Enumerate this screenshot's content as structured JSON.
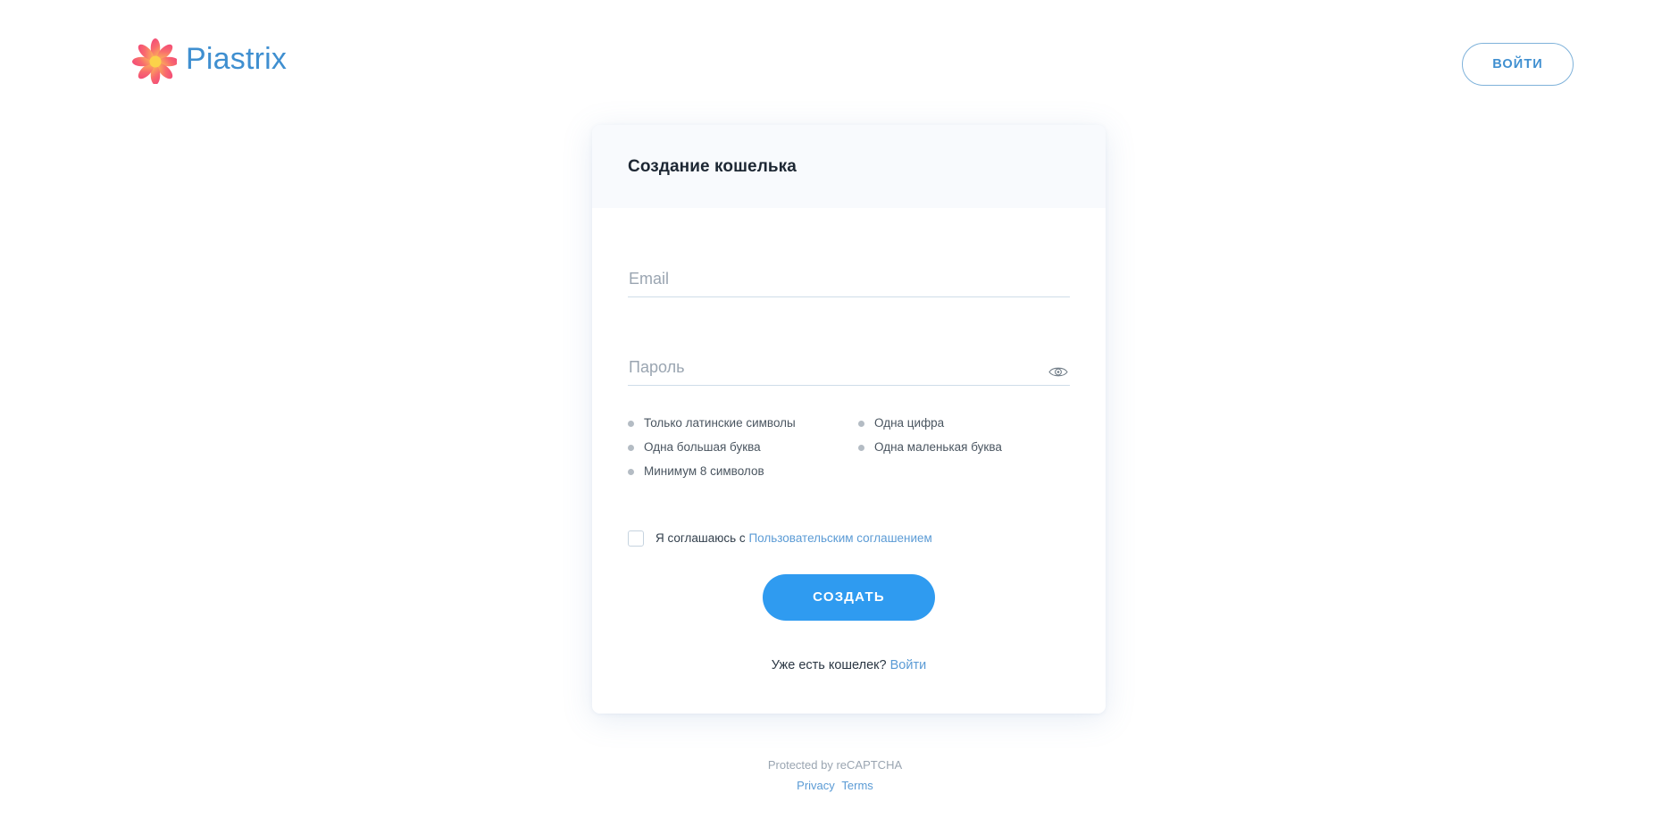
{
  "header": {
    "brand_name": "Piastrix",
    "brand_icon": "piastrix-flower-logo",
    "login_label": "ВОЙТИ"
  },
  "card": {
    "title": "Создание кошелька",
    "email": {
      "label": "Email",
      "placeholder": "Email",
      "value": ""
    },
    "password": {
      "label": "Пароль",
      "placeholder": "Пароль",
      "value": "",
      "toggle_icon": "eye-icon"
    },
    "requirements": [
      "Только латинские символы",
      "Одна цифра",
      "Одна большая буква",
      "Одна маленькая буква",
      "Минимум 8 символов"
    ],
    "agreement": {
      "prefix": "Я соглашаюсь с",
      "link_label": "Пользовательским соглашением",
      "checked": false
    },
    "submit_label": "СОЗДАТЬ",
    "footer": {
      "prompt": "Уже есть кошелек?",
      "link_label": "Войти"
    }
  },
  "recaptcha": {
    "notice": "Protected by reCAPTCHA",
    "privacy_label": "Privacy",
    "terms_label": "Terms"
  },
  "colors": {
    "accent_blue": "#2f9bf0",
    "link_blue": "#5b9bd5",
    "brand_blue": "#3f8fd0",
    "petal_pink": "#f2547d",
    "petal_orange": "#f98b62",
    "flower_center": "#fbd24a",
    "page_bg": "#ffffff",
    "card_header_bg": "#f8fafd",
    "field_underline": "#cfdde8",
    "bullet_gray": "#b4bcc4"
  }
}
